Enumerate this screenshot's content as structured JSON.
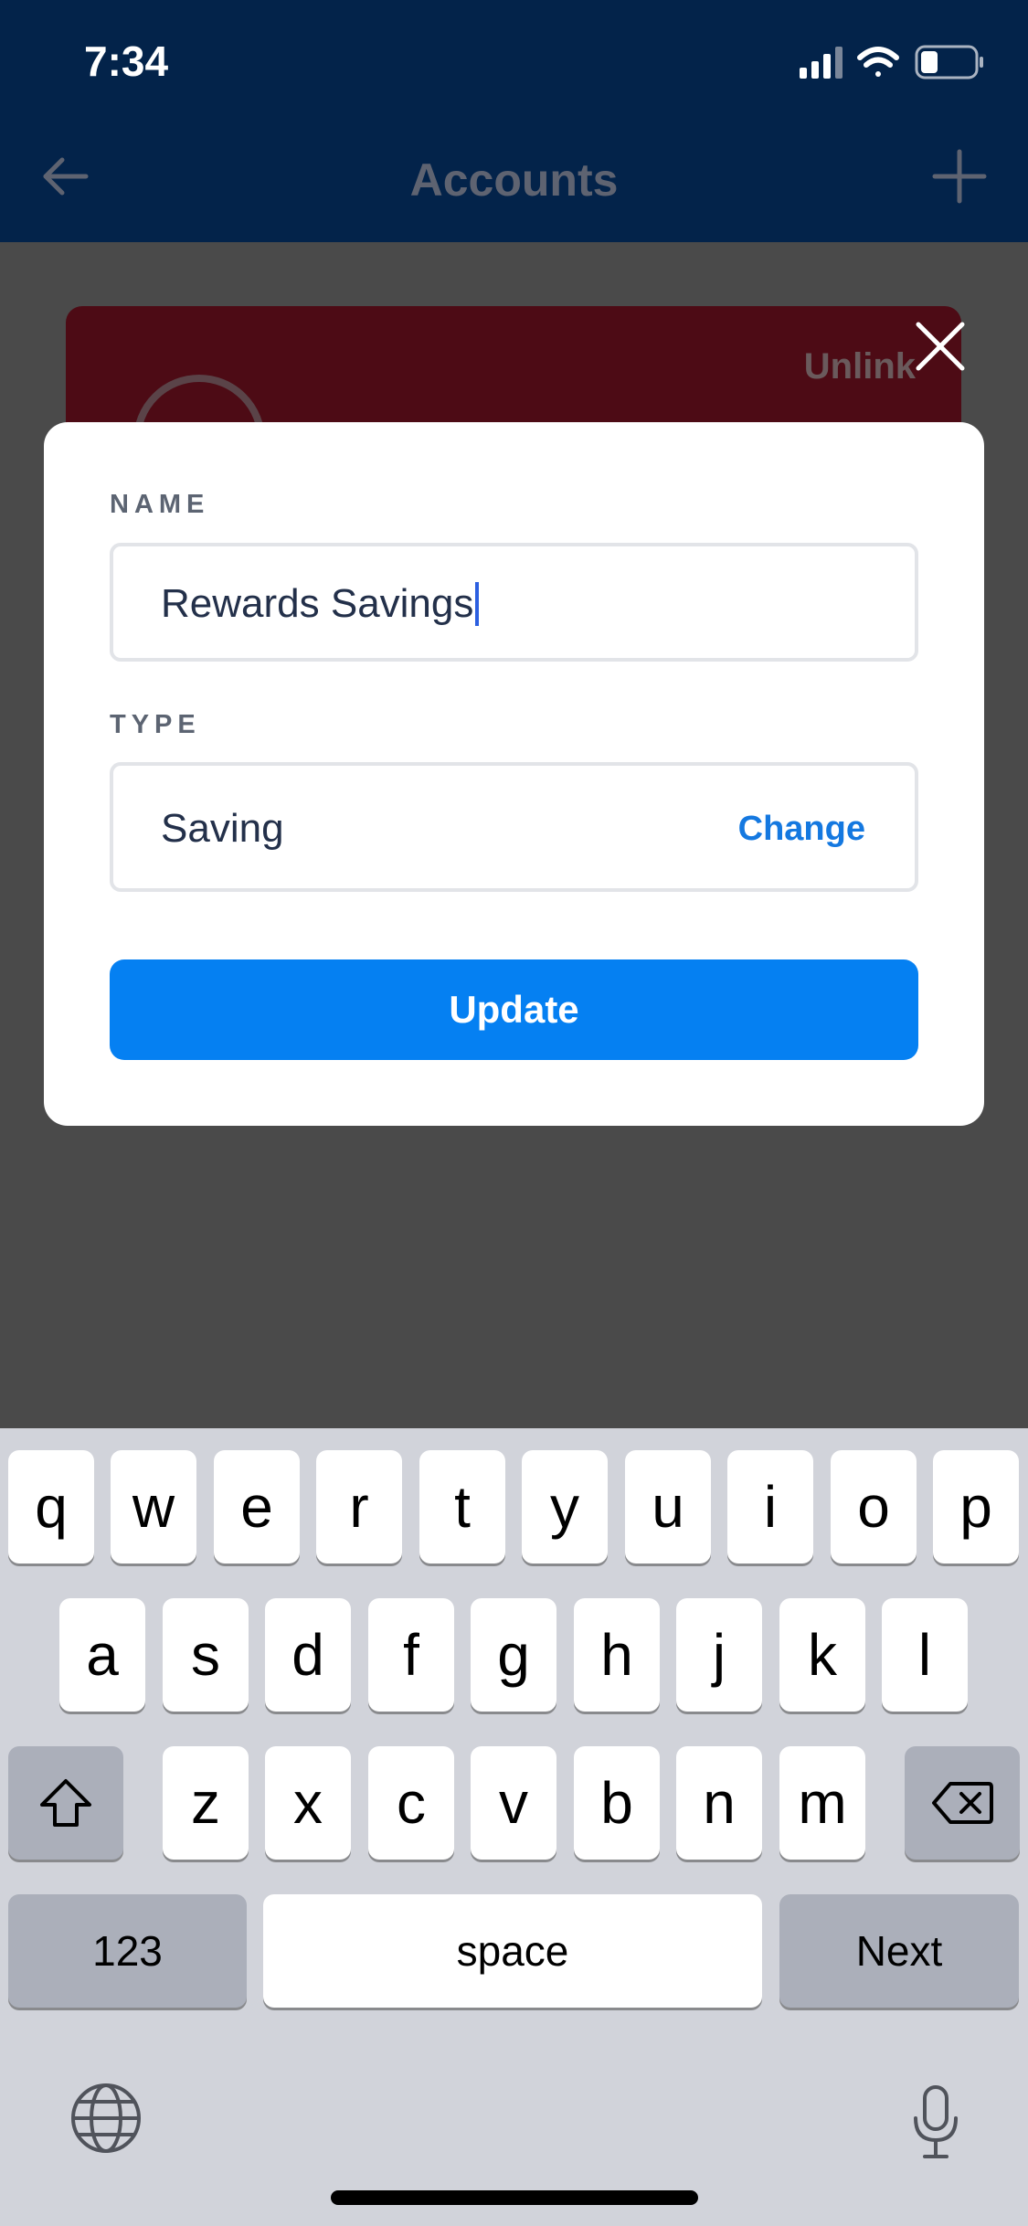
{
  "status_bar": {
    "time": "7:34"
  },
  "nav": {
    "title": "Accounts"
  },
  "background_card": {
    "unlink_label": "Unlink"
  },
  "modal": {
    "name_label": "NAME",
    "name_value": "Rewards Savings",
    "type_label": "TYPE",
    "type_value": "Saving",
    "change_label": "Change",
    "update_label": "Update"
  },
  "keyboard": {
    "row1": [
      "q",
      "w",
      "e",
      "r",
      "t",
      "y",
      "u",
      "i",
      "o",
      "p"
    ],
    "row2": [
      "a",
      "s",
      "d",
      "f",
      "g",
      "h",
      "j",
      "k",
      "l"
    ],
    "row3": [
      "z",
      "x",
      "c",
      "v",
      "b",
      "n",
      "m"
    ],
    "numbers_label": "123",
    "space_label": "space",
    "next_label": "Next"
  },
  "icons": {
    "back": "arrow-left-icon",
    "add": "plus-icon",
    "close": "close-icon",
    "shift": "shift-icon",
    "delete": "backspace-icon",
    "globe": "globe-icon",
    "mic": "microphone-icon"
  },
  "colors": {
    "nav_background": "#03234a",
    "primary": "#0580f2",
    "link": "#1478e0",
    "card": "#4d0b15",
    "overlay": "#4a4a4a"
  }
}
